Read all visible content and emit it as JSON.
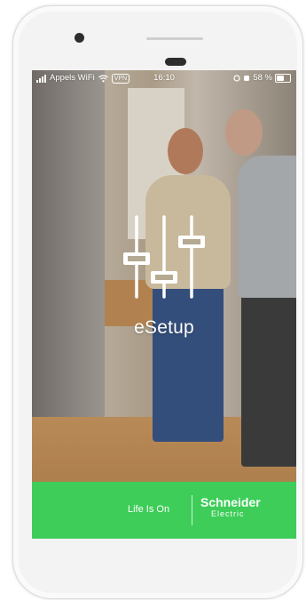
{
  "status_bar": {
    "carrier": "Appels WiFi",
    "vpn_label": "VPN",
    "time": "16:10",
    "battery": "58 %"
  },
  "splash": {
    "app_name": "eSetup",
    "logo_icon": "sliders-icon"
  },
  "footer": {
    "tagline": "Life Is On",
    "brand_name": "Schneider",
    "brand_sub": "Electric",
    "background_color": "#3dcd58"
  },
  "device": {
    "frame_color": "#f3f3f3",
    "camera_icon": "camera-icon",
    "speaker_icon": "speaker-icon"
  }
}
